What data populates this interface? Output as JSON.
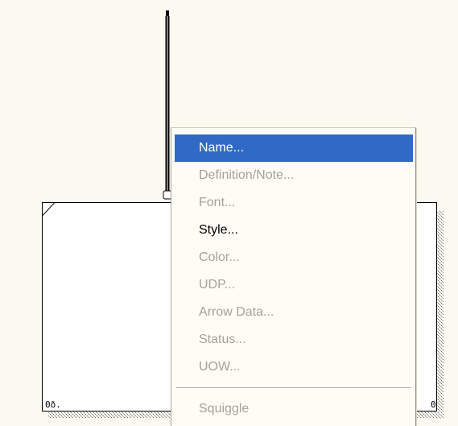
{
  "diagram": {
    "left_box_label": "0ð.",
    "right_box_label": "0"
  },
  "context_menu": {
    "items": [
      {
        "label": "Name...",
        "enabled": true,
        "selected": true
      },
      {
        "label": "Definition/Note...",
        "enabled": false,
        "selected": false
      },
      {
        "label": "Font...",
        "enabled": false,
        "selected": false
      },
      {
        "label": "Style...",
        "enabled": true,
        "selected": false
      },
      {
        "label": "Color...",
        "enabled": false,
        "selected": false
      },
      {
        "label": "UDP...",
        "enabled": false,
        "selected": false
      },
      {
        "label": "Arrow Data...",
        "enabled": false,
        "selected": false
      },
      {
        "label": "Status...",
        "enabled": false,
        "selected": false
      },
      {
        "label": "UOW...",
        "enabled": false,
        "selected": false
      },
      {
        "label": "Squiggle",
        "enabled": false,
        "selected": false
      }
    ]
  },
  "colors": {
    "canvas_background": "#fcf9f0",
    "menu_background": "#fefcf5",
    "highlight": "#316ac5",
    "disabled_text": "#a3a29b"
  }
}
